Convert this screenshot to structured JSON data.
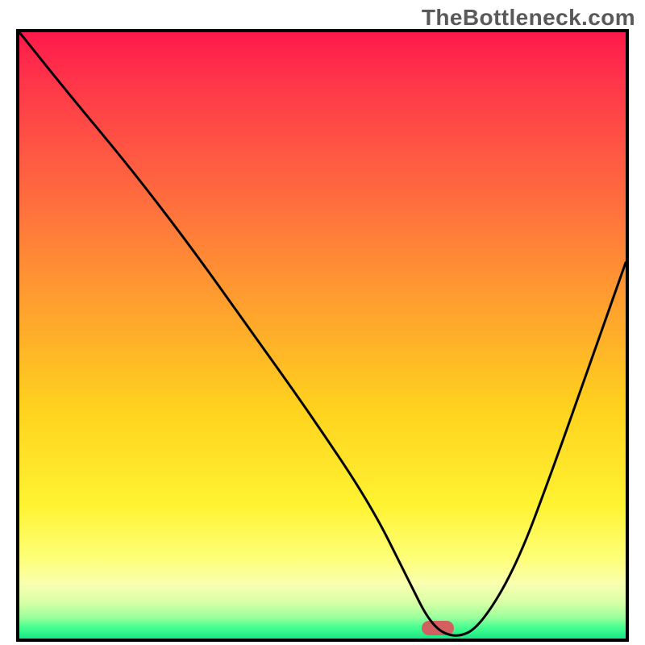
{
  "watermark": "TheBottleneck.com",
  "chart_data": {
    "type": "line",
    "title": "",
    "xlabel": "",
    "ylabel": "",
    "xlim": [
      0,
      100
    ],
    "ylim": [
      0,
      100
    ],
    "series": [
      {
        "name": "curve",
        "x": [
          0,
          8,
          18,
          28,
          38,
          48,
          58,
          64,
          68,
          72,
          76,
          82,
          88,
          94,
          100
        ],
        "values": [
          100,
          90,
          78,
          65,
          51,
          37,
          22,
          10,
          2,
          0,
          2,
          12,
          28,
          45,
          62
        ]
      }
    ],
    "marker": {
      "x": 69,
      "y": 0.5,
      "width_pct": 5.3,
      "height_pct": 2.4
    },
    "gradient_stops": [
      {
        "pct": 0,
        "color": "#ff1a4b"
      },
      {
        "pct": 10,
        "color": "#ff3b49"
      },
      {
        "pct": 28,
        "color": "#ff6e3e"
      },
      {
        "pct": 45,
        "color": "#ffa02e"
      },
      {
        "pct": 62,
        "color": "#ffd21e"
      },
      {
        "pct": 78,
        "color": "#fff332"
      },
      {
        "pct": 87,
        "color": "#feff7a"
      },
      {
        "pct": 91,
        "color": "#f9ffb0"
      },
      {
        "pct": 94,
        "color": "#d9ffa6"
      },
      {
        "pct": 96.5,
        "color": "#9cff9c"
      },
      {
        "pct": 98,
        "color": "#4dff92"
      },
      {
        "pct": 100,
        "color": "#17e884"
      }
    ]
  }
}
